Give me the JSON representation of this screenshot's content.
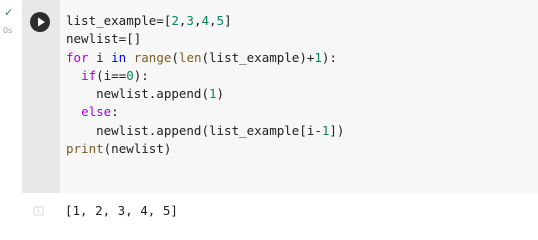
{
  "cell": {
    "status": "✓",
    "exec_time": "0s",
    "run_icon": "play-icon",
    "output_icon": "output-clear-icon"
  },
  "code": {
    "lines": [
      [
        {
          "t": "list_example=[",
          "c": ""
        },
        {
          "t": "2",
          "c": "num"
        },
        {
          "t": ",",
          "c": ""
        },
        {
          "t": "3",
          "c": "num"
        },
        {
          "t": ",",
          "c": ""
        },
        {
          "t": "4",
          "c": "num"
        },
        {
          "t": ",",
          "c": ""
        },
        {
          "t": "5",
          "c": "num"
        },
        {
          "t": "]",
          "c": ""
        }
      ],
      [
        {
          "t": "newlist=[]",
          "c": ""
        }
      ],
      [
        {
          "t": "for",
          "c": "kw2"
        },
        {
          "t": " i ",
          "c": ""
        },
        {
          "t": "in",
          "c": "kw"
        },
        {
          "t": " ",
          "c": ""
        },
        {
          "t": "range",
          "c": "fn"
        },
        {
          "t": "(",
          "c": ""
        },
        {
          "t": "len",
          "c": "fn"
        },
        {
          "t": "(list_example)+",
          "c": ""
        },
        {
          "t": "1",
          "c": "num"
        },
        {
          "t": "):",
          "c": ""
        }
      ],
      [
        {
          "t": "  ",
          "c": ""
        },
        {
          "t": "if",
          "c": "kw2"
        },
        {
          "t": "(i==",
          "c": ""
        },
        {
          "t": "0",
          "c": "num"
        },
        {
          "t": "):",
          "c": ""
        }
      ],
      [
        {
          "t": "    newlist.append(",
          "c": ""
        },
        {
          "t": "1",
          "c": "num"
        },
        {
          "t": ")",
          "c": ""
        }
      ],
      [
        {
          "t": "  ",
          "c": ""
        },
        {
          "t": "else",
          "c": "kw2"
        },
        {
          "t": ":",
          "c": ""
        }
      ],
      [
        {
          "t": "    newlist.append(list_example[i-",
          "c": ""
        },
        {
          "t": "1",
          "c": "num"
        },
        {
          "t": "])",
          "c": ""
        }
      ],
      [
        {
          "t": "print",
          "c": "fn"
        },
        {
          "t": "(newlist)",
          "c": ""
        }
      ]
    ]
  },
  "output": {
    "text": "[1, 2, 3, 4, 5]"
  },
  "colors": {
    "keyword_flow": "#af00db",
    "keyword": "#0000ff",
    "function": "#795e26",
    "number": "#098658",
    "success": "#1e8e3e"
  }
}
